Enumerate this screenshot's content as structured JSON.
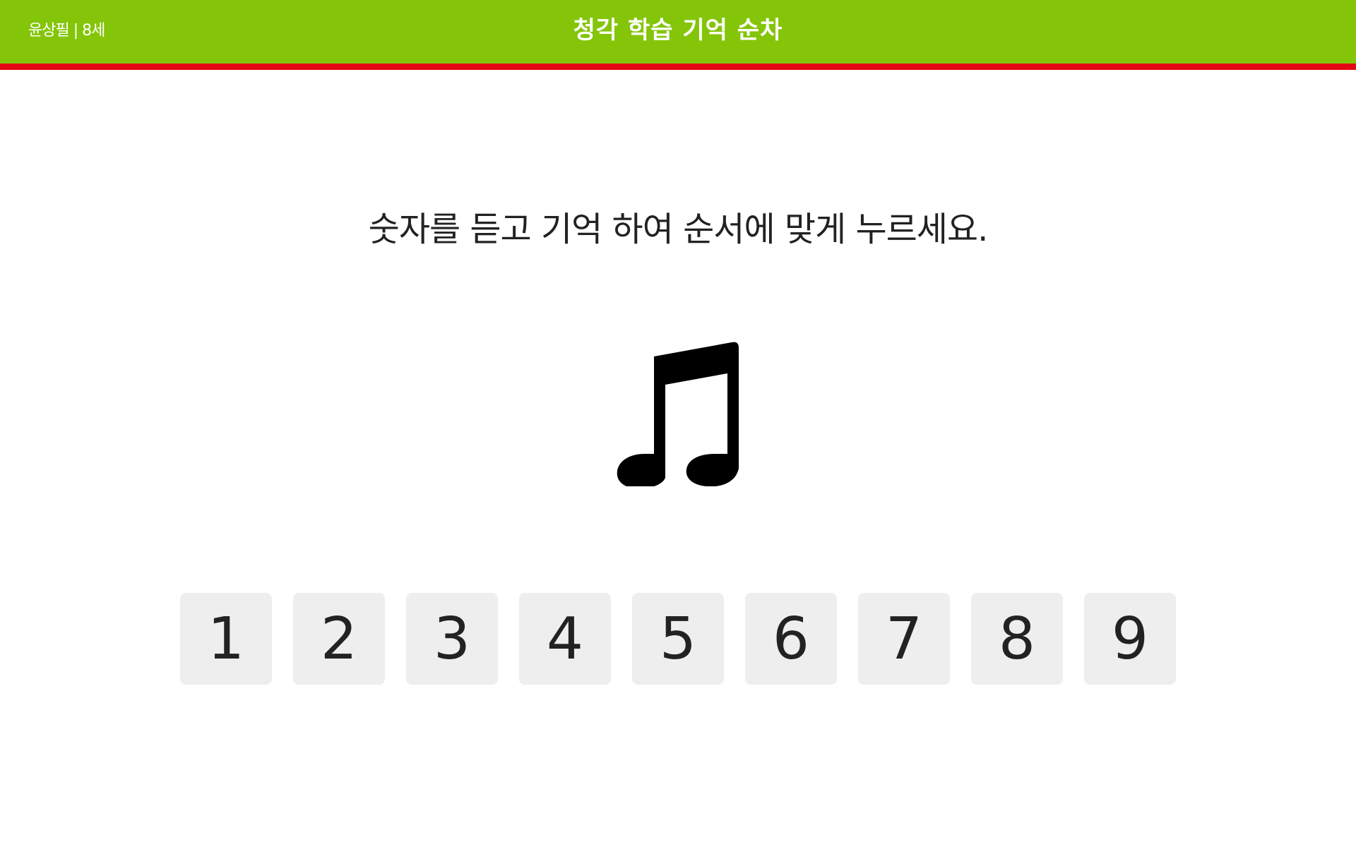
{
  "header": {
    "user_name": "윤상필",
    "separator": "|",
    "age": "8세",
    "title": "청각 학습 기억 순차",
    "bar_color": "#84c50a",
    "accent_color": "#e30613"
  },
  "main": {
    "instruction": "숫자를 듣고 기억 하여 순서에 맞게 누르세요.",
    "sound_icon": "music-note-icon"
  },
  "keypad": {
    "keys": [
      "1",
      "2",
      "3",
      "4",
      "5",
      "6",
      "7",
      "8",
      "9"
    ]
  }
}
